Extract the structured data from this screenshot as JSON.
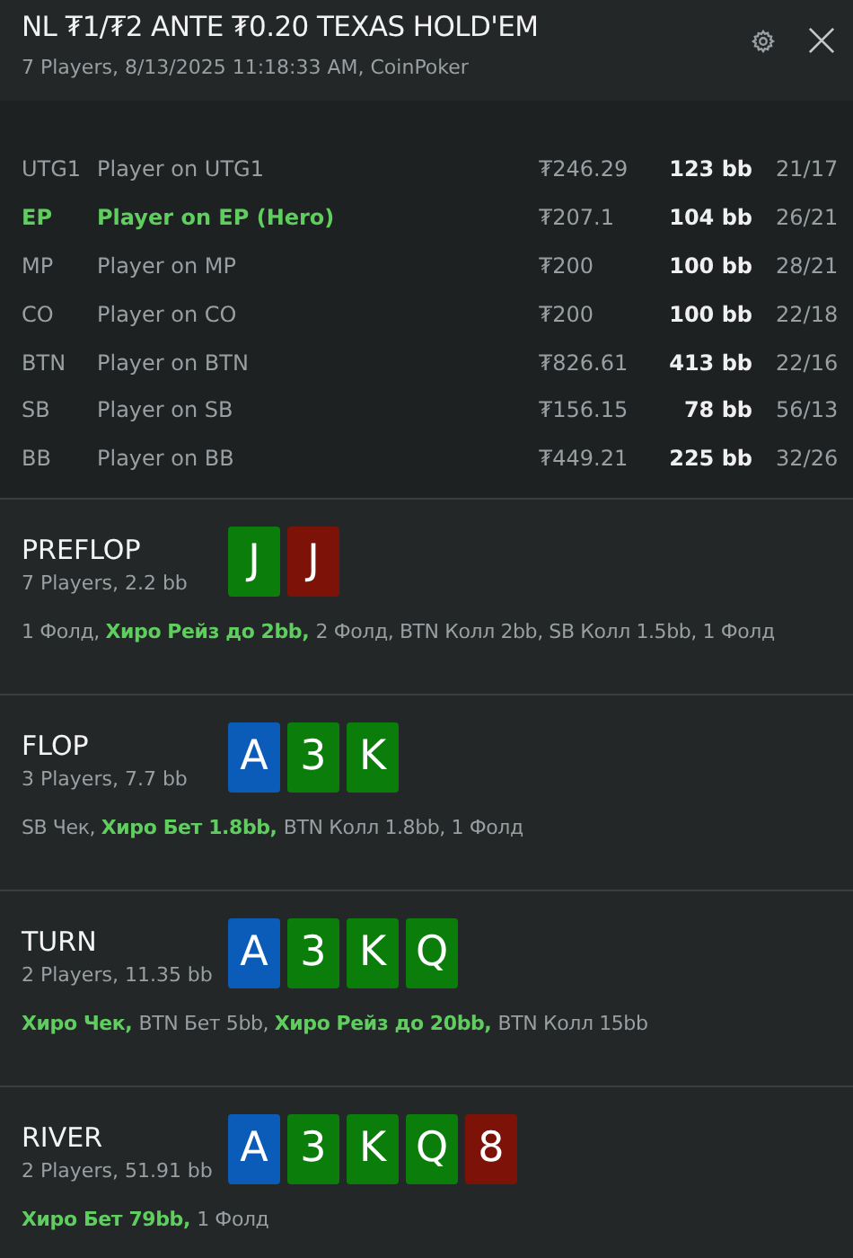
{
  "header": {
    "title": "NL ₮1/₮2 ANTE ₮0.20 TEXAS HOLD'EM",
    "subtitle": "7 Players, 8/13/2025 11:18:33 AM, CoinPoker"
  },
  "players": [
    {
      "position": "UTG1",
      "name": "Player on UTG1",
      "stack": "₮246.29",
      "bb": "123 bb",
      "stats": "21/17",
      "hero": false
    },
    {
      "position": "EP",
      "name": "Player on EP (Hero)",
      "stack": "₮207.1",
      "bb": "104 bb",
      "stats": "26/21",
      "hero": true
    },
    {
      "position": "MP",
      "name": "Player on MP",
      "stack": "₮200",
      "bb": "100 bb",
      "stats": "28/21",
      "hero": false
    },
    {
      "position": "CO",
      "name": "Player on CO",
      "stack": "₮200",
      "bb": "100 bb",
      "stats": "22/18",
      "hero": false
    },
    {
      "position": "BTN",
      "name": "Player on BTN",
      "stack": "₮826.61",
      "bb": "413 bb",
      "stats": "22/16",
      "hero": false
    },
    {
      "position": "SB",
      "name": "Player on SB",
      "stack": "₮156.15",
      "bb": "78 bb",
      "stats": "56/13",
      "hero": false
    },
    {
      "position": "BB",
      "name": "Player on BB",
      "stack": "₮449.21",
      "bb": "225 bb",
      "stats": "32/26",
      "hero": false
    }
  ],
  "streets": [
    {
      "name": "PREFLOP",
      "info": "7 Players, 2.2 bb",
      "cards": [
        {
          "rank": "J",
          "color": "#0a7d0a"
        },
        {
          "rank": "J",
          "color": "#7d1208"
        }
      ],
      "actions": [
        {
          "text": "1 Фолд, ",
          "hero": false
        },
        {
          "text": "Хиро Рейз до 2bb, ",
          "hero": true
        },
        {
          "text": "2 Фолд, BTN Колл 2bb, SB Колл 1.5bb, 1 Фолд",
          "hero": false
        }
      ]
    },
    {
      "name": "FLOP",
      "info": "3 Players, 7.7 bb",
      "cards": [
        {
          "rank": "A",
          "color": "#0b5cb8"
        },
        {
          "rank": "3",
          "color": "#0a7d0a"
        },
        {
          "rank": "K",
          "color": "#0a7d0a"
        }
      ],
      "actions": [
        {
          "text": "SB Чек, ",
          "hero": false
        },
        {
          "text": "Хиро Бет 1.8bb, ",
          "hero": true
        },
        {
          "text": "BTN Колл 1.8bb, 1 Фолд",
          "hero": false
        }
      ]
    },
    {
      "name": "TURN",
      "info": "2 Players, 11.35 bb",
      "cards": [
        {
          "rank": "A",
          "color": "#0b5cb8"
        },
        {
          "rank": "3",
          "color": "#0a7d0a"
        },
        {
          "rank": "K",
          "color": "#0a7d0a"
        },
        {
          "rank": "Q",
          "color": "#0a7d0a"
        }
      ],
      "actions": [
        {
          "text": "Хиро Чек, ",
          "hero": true
        },
        {
          "text": "BTN Бет 5bb, ",
          "hero": false
        },
        {
          "text": "Хиро Рейз до 20bb, ",
          "hero": true
        },
        {
          "text": "BTN Колл 15bb",
          "hero": false
        }
      ]
    },
    {
      "name": "RIVER",
      "info": "2 Players, 51.91 bb",
      "cards": [
        {
          "rank": "A",
          "color": "#0b5cb8"
        },
        {
          "rank": "3",
          "color": "#0a7d0a"
        },
        {
          "rank": "K",
          "color": "#0a7d0a"
        },
        {
          "rank": "Q",
          "color": "#0a7d0a"
        },
        {
          "rank": "8",
          "color": "#7d1208"
        }
      ],
      "actions": [
        {
          "text": "Хиро Бет 79bb, ",
          "hero": true
        },
        {
          "text": "1 Фолд",
          "hero": false
        }
      ]
    }
  ]
}
